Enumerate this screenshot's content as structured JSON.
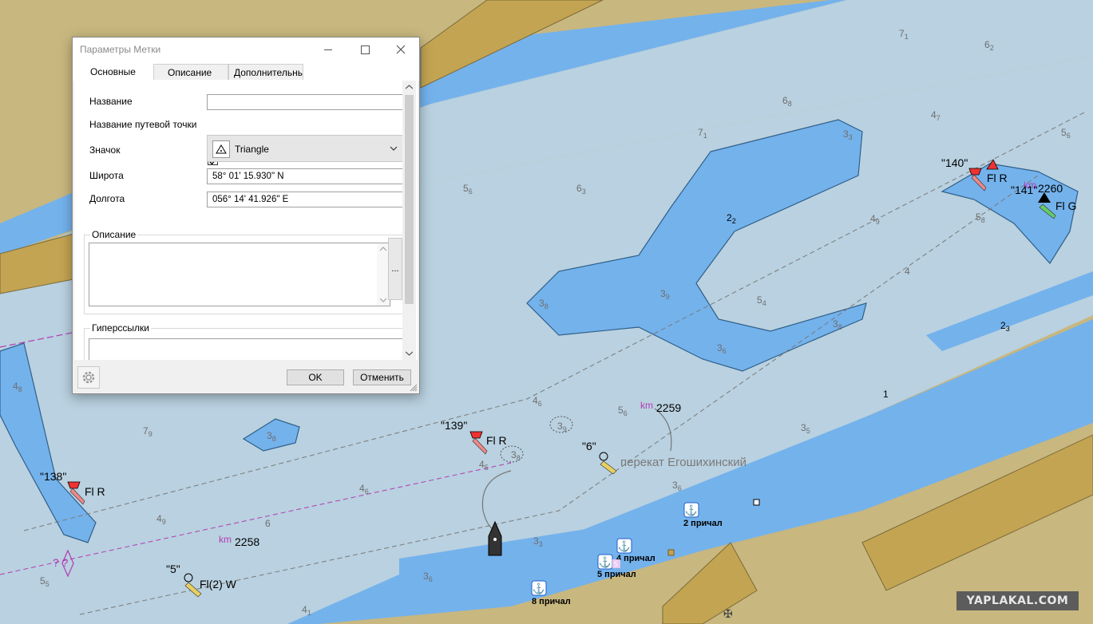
{
  "dialog": {
    "title": "Параметры Метки",
    "tabs": [
      "Основные",
      "Описание",
      "Дополнительные"
    ],
    "fields": {
      "name_label": "Название",
      "name_value": "",
      "waypoint_name_label": "Название путевой точки",
      "waypoint_name_checked": true,
      "icon_label": "Значок",
      "icon_value": "Triangle",
      "lat_label": "Широта",
      "lat_value": "58° 01' 15.930\" N",
      "lon_label": "Долгота",
      "lon_value": "056° 14' 41.926\" E"
    },
    "description_group": "Описание",
    "description_button": "...",
    "hyperlinks_group": "Гиперссылки",
    "ok_label": "OK",
    "cancel_label": "Отменить"
  },
  "map": {
    "colors": {
      "land": "#c8b77f",
      "shallow": "#74b2ec",
      "deep": "#b9d1e0",
      "shore": "#c3a452",
      "km_marker": "#b33cb3"
    },
    "buoys": [
      {
        "id": "138",
        "name": "\"138\"",
        "light": "Fl R"
      },
      {
        "id": "139",
        "name": "\"139\"",
        "light": "Fl R"
      },
      {
        "id": "140",
        "name": "\"140\"",
        "light": "Fl R"
      },
      {
        "id": "141",
        "name": "\"141\"",
        "light": "Fl G"
      },
      {
        "id": "5",
        "name": "\"5\"",
        "light": "Fl(2) W"
      },
      {
        "id": "6",
        "name": "\"6\"",
        "light": ""
      }
    ],
    "km_markers": [
      {
        "label": "km",
        "value": "2258"
      },
      {
        "label": "km",
        "value": "2259"
      },
      {
        "label": "km",
        "value": "2260"
      }
    ],
    "place_name": "перекат Егошихинский",
    "berths": [
      "2 причал",
      "4 причал",
      "5 причал",
      "8 причал"
    ],
    "berth_badge": "5",
    "depths": [
      {
        "main": "7",
        "sub": "1"
      },
      {
        "main": "6",
        "sub": "2"
      },
      {
        "main": "6",
        "sub": "8"
      },
      {
        "main": "4",
        "sub": "7"
      },
      {
        "main": "5",
        "sub": "6"
      },
      {
        "main": "7",
        "sub": "1"
      },
      {
        "main": "3",
        "sub": "3"
      },
      {
        "main": "5",
        "sub": "6"
      },
      {
        "main": "6",
        "sub": "3"
      },
      {
        "main": "2",
        "sub": "2"
      },
      {
        "main": "4",
        "sub": "9"
      },
      {
        "main": "5",
        "sub": "8"
      },
      {
        "main": "3",
        "sub": "8"
      },
      {
        "main": "3",
        "sub": "9"
      },
      {
        "main": "5",
        "sub": "4"
      },
      {
        "main": "4",
        "sub": ""
      },
      {
        "main": "3",
        "sub": "8"
      },
      {
        "main": "2",
        "sub": "3"
      },
      {
        "main": "3",
        "sub": "6"
      },
      {
        "main": "4",
        "sub": "8"
      },
      {
        "main": "4",
        "sub": "6"
      },
      {
        "main": "5",
        "sub": "6"
      },
      {
        "main": "7",
        "sub": "9"
      },
      {
        "main": "3",
        "sub": "8"
      },
      {
        "main": "1",
        "sub": ""
      },
      {
        "main": "3",
        "sub": "5"
      },
      {
        "main": "4",
        "sub": "5"
      },
      {
        "main": "3",
        "sub": "8"
      },
      {
        "main": "4",
        "sub": "6"
      },
      {
        "main": "3",
        "sub": "6"
      },
      {
        "main": "4",
        "sub": "9"
      },
      {
        "main": "6",
        "sub": ""
      },
      {
        "main": "3",
        "sub": "3"
      },
      {
        "main": "3",
        "sub": "6"
      },
      {
        "main": "5",
        "sub": "5"
      },
      {
        "main": "4",
        "sub": "1"
      },
      {
        "main": "3",
        "sub": "9"
      }
    ],
    "unknown_marks": "? ?"
  },
  "watermark": "YAPLAKAL.COM"
}
